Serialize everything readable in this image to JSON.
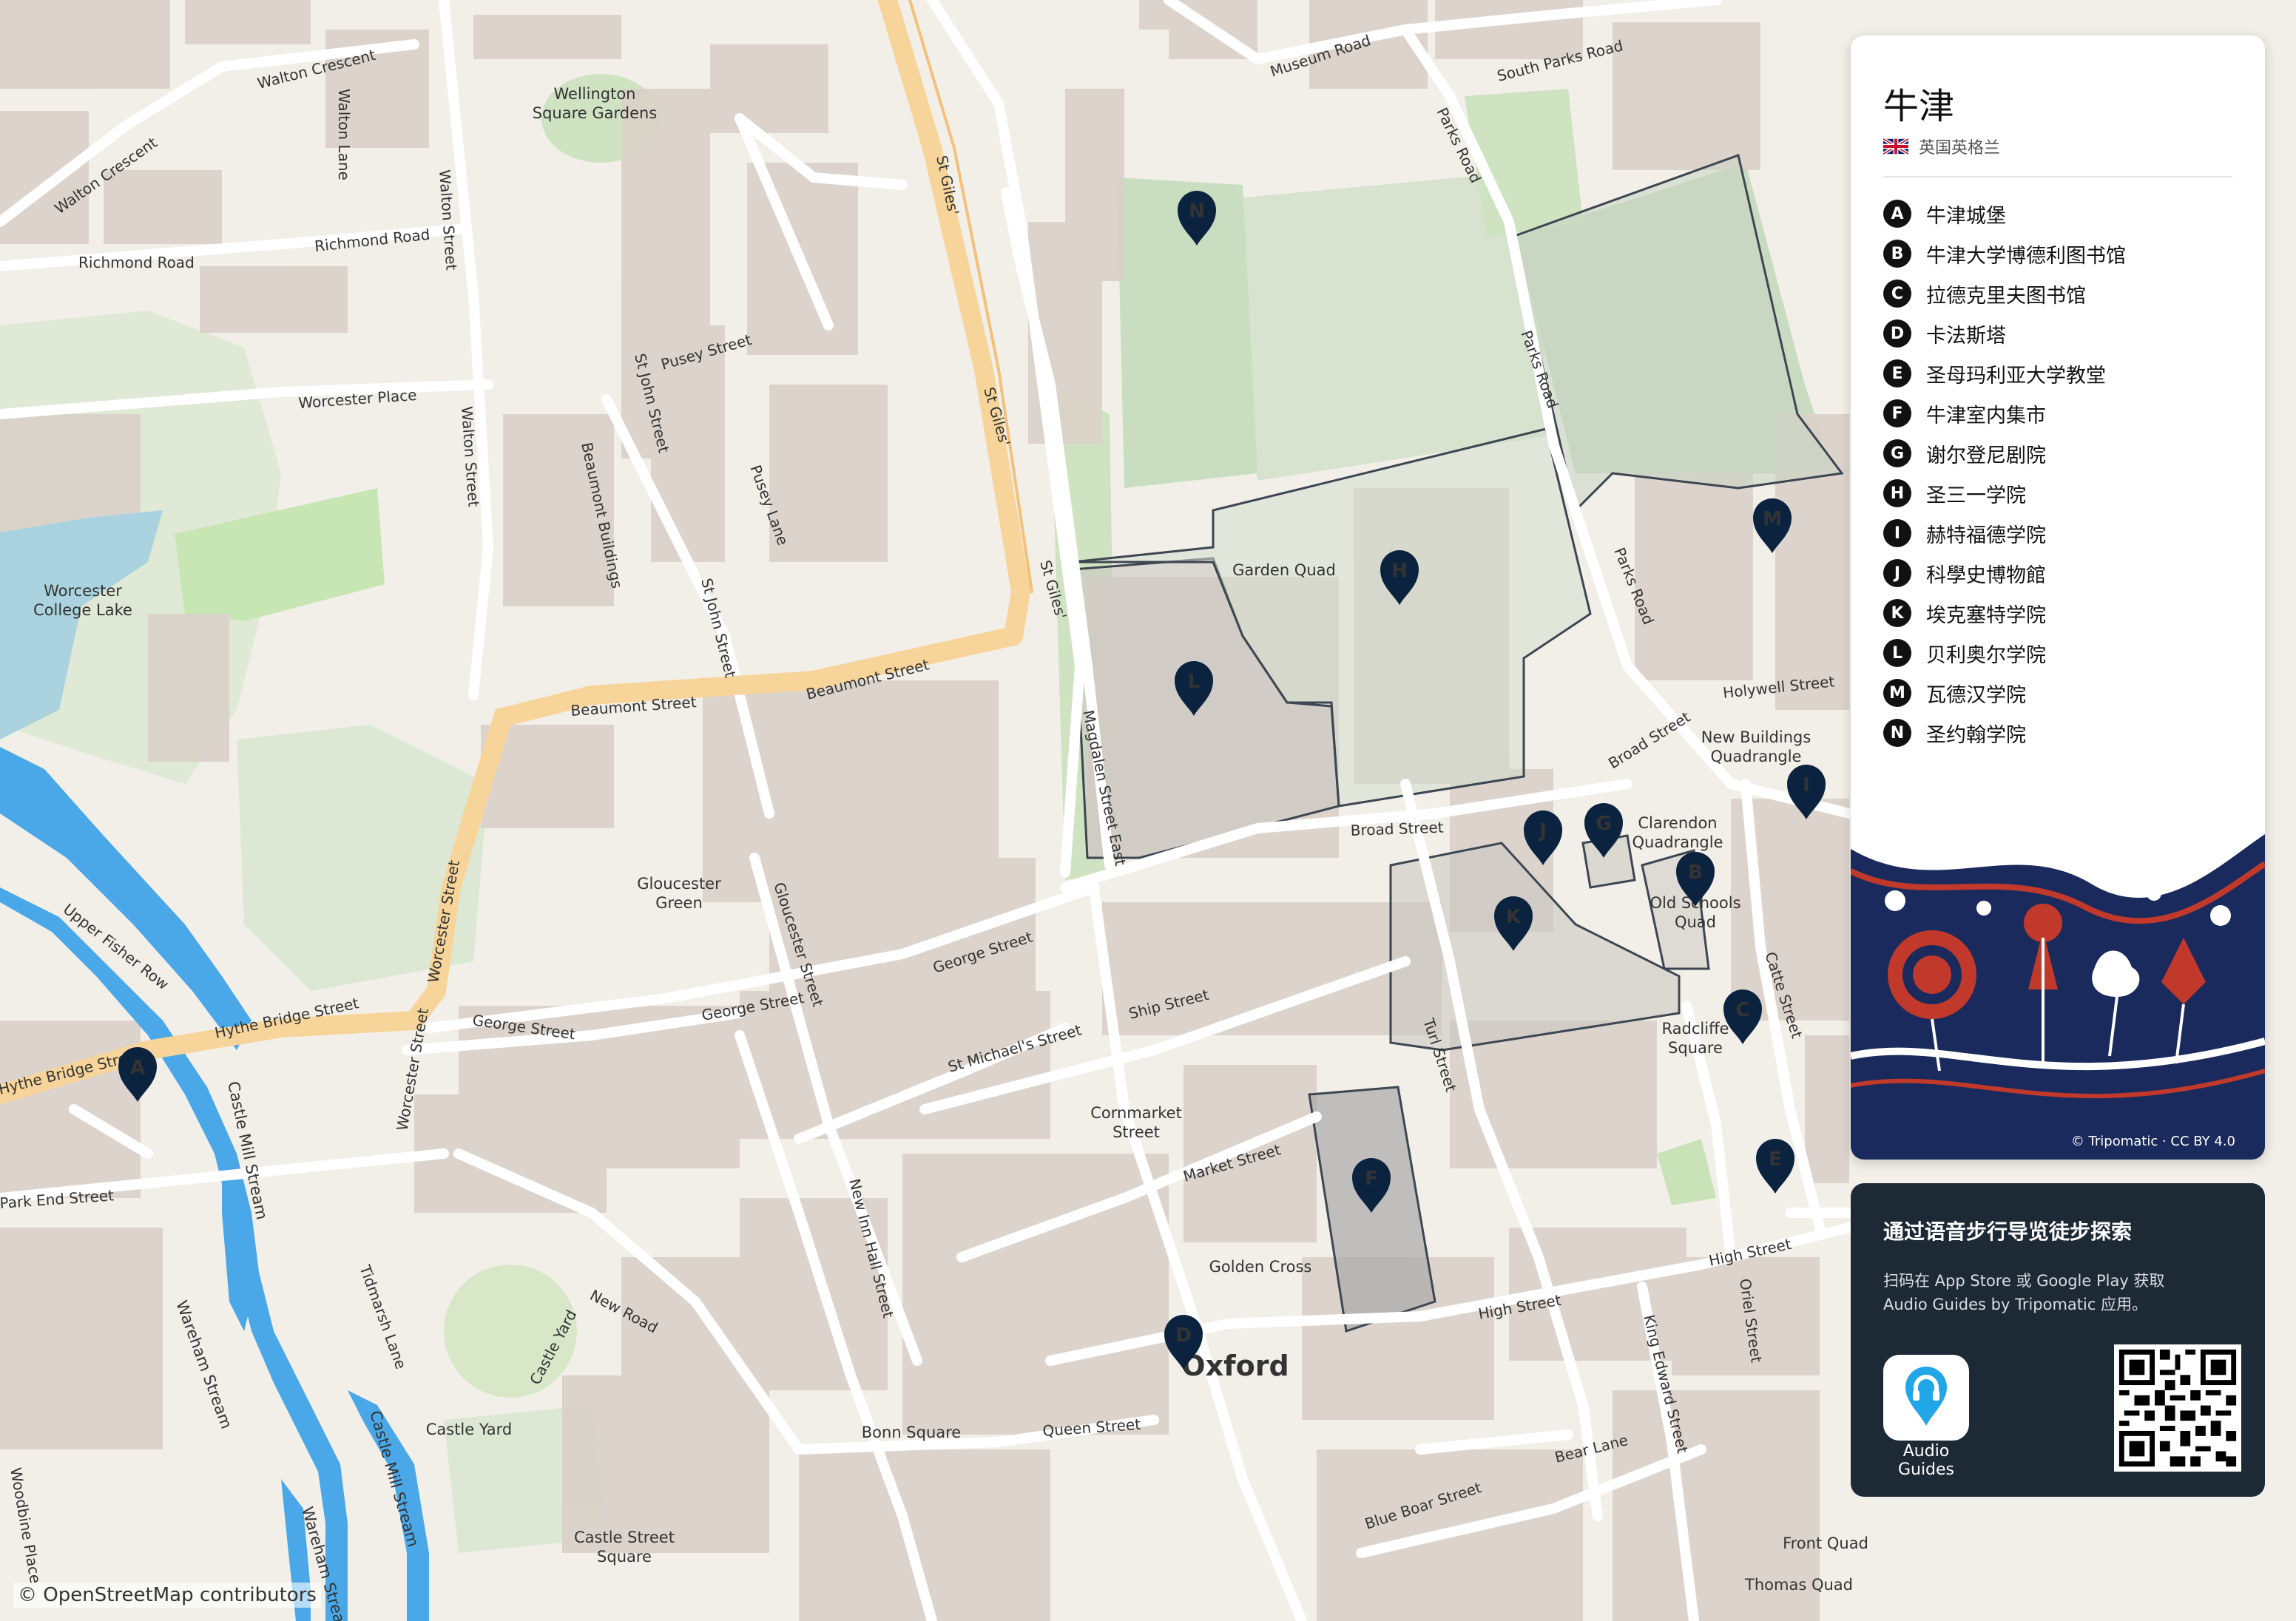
{
  "colors": {
    "background": "#f2efe9",
    "building": "#d9d0c9",
    "water": "#aad3df",
    "river": "#4aa8e8",
    "park": "#c8e6b4",
    "college_grounds": "#d7e3cf",
    "major_road": "#f7d49a",
    "pin": "#0c2340",
    "panel_dark": "#1e2936",
    "accent_red": "#c0392b"
  },
  "city": "牛津",
  "country": "英国英格兰",
  "flag_icon": "uk-flag-icon",
  "pois": [
    {
      "letter": "A",
      "name": "牛津城堡"
    },
    {
      "letter": "B",
      "name": "牛津大学博德利图书馆"
    },
    {
      "letter": "C",
      "name": "拉德克里夫图书馆"
    },
    {
      "letter": "D",
      "name": "卡法斯塔"
    },
    {
      "letter": "E",
      "name": "圣母玛利亚大学教堂"
    },
    {
      "letter": "F",
      "name": "牛津室内集市"
    },
    {
      "letter": "G",
      "name": "谢尔登尼剧院"
    },
    {
      "letter": "H",
      "name": "圣三一学院"
    },
    {
      "letter": "I",
      "name": "赫特福德学院"
    },
    {
      "letter": "J",
      "name": "科學史博物館"
    },
    {
      "letter": "K",
      "name": "埃克塞特学院"
    },
    {
      "letter": "L",
      "name": "贝利奥尔学院"
    },
    {
      "letter": "M",
      "name": "瓦德汉学院"
    },
    {
      "letter": "N",
      "name": "圣约翰学院"
    }
  ],
  "map_credit": "© Tripomatic · CC BY 4.0",
  "promo": {
    "title": "通过语音步行导览徒步探索",
    "text": "扫码在 App Store 或 Google Play 获取 Audio Guides by Tripomatic 应用。",
    "app_label": "Audio Guides"
  },
  "osm_credit": "© OpenStreetMap contributors",
  "map_labels": {
    "city_center": "Oxford",
    "places": {
      "wellington": [
        "Wellington",
        "Square Gardens"
      ],
      "worcester_lake": [
        "Worcester",
        "College Lake"
      ],
      "gloucester_green": [
        "Gloucester",
        "Green"
      ],
      "garden_quad": "Garden Quad",
      "new_buildings": [
        "New Buildings",
        "Quadrangle"
      ],
      "clarendon": [
        "Clarendon",
        "Quadrangle"
      ],
      "old_schools": [
        "Old Schools",
        "Quad"
      ],
      "radcliffe_square": [
        "Radcliffe",
        "Square"
      ],
      "cornmarket": [
        "Cornmarket",
        "Street"
      ],
      "golden_cross": "Golden Cross",
      "castle_yard": "Castle Yard",
      "castle_street_square": [
        "Castle Street",
        "Square"
      ],
      "bonn_square": "Bonn Square",
      "front_quad": "Front Quad",
      "thomas_quad": "Thomas Quad"
    },
    "roads": {
      "walton_crescent_1": "Walton Crescent",
      "walton_crescent_2": "Walton Crescent",
      "walton_lane": "Walton Lane",
      "richmond_road_1": "Richmond Road",
      "richmond_road_2": "Richmond Road",
      "walton_street_1": "Walton Street",
      "walton_street_2": "Walton Street",
      "worcester_place": "Worcester Place",
      "pusey_street": "Pusey Street",
      "st_john_street_1": "St John Street",
      "st_john_street_2": "St John Street",
      "beaumont_buildings": "Beaumont Buildings",
      "pusey_lane": "Pusey Lane",
      "st_giles_1": "St Giles'",
      "st_giles_2": "St Giles'",
      "st_giles_3": "St Giles'",
      "museum_road": "Museum Road",
      "south_parks_road": "South Parks Road",
      "parks_road_1": "Parks Road",
      "parks_road_2": "Parks Road",
      "parks_road_3": "Parks Road",
      "beaumont_street_1": "Beaumont Street",
      "beaumont_street_2": "Beaumont Street",
      "magdalen_street_east": "Magdalen Street East",
      "broad_street_1": "Broad Street",
      "broad_street_2": "Broad Street",
      "holywell_street": "Holywell Street",
      "upper_fisher_row": "Upper Fisher Row",
      "hythe_bridge_1": "Hythe Bridge Street",
      "hythe_bridge_2": "Hythe Bridge Street",
      "worcester_street_1": "Worcester Street",
      "worcester_street_2": "Worcester Street",
      "gloucester_street": "Gloucester Street",
      "george_street_1": "George Street",
      "george_street_2": "George Street",
      "george_street_3": "George Street",
      "ship_street": "Ship Street",
      "st_michaels_street": "St Michael's Street",
      "turl_street": "Turl Street",
      "catte_street": "Catte Street",
      "market_street": "Market Street",
      "high_street_1": "High Street",
      "high_street_2": "High Street",
      "park_end_street": "Park End Street",
      "tidmarsh_lane": "Tidmarsh Lane",
      "castle_yard_road": "Castle Yard",
      "new_road": "New Road",
      "new_inn_hall_street": "New Inn Hall Street",
      "queen_street": "Queen Street",
      "king_edward_street": "King Edward Street",
      "oriel_street": "Oriel Street",
      "bear_lane": "Bear Lane",
      "blue_boar_street": "Blue Boar Street",
      "woodbine_place": "Woodbine Place"
    },
    "water": {
      "castle_mill_stream_1": "Castle Mill Stream",
      "castle_mill_stream_2": "Castle Mill Stream",
      "wareham_stream_1": "Wareham Stream",
      "wareham_stream_2": "Wareham Stream"
    }
  }
}
